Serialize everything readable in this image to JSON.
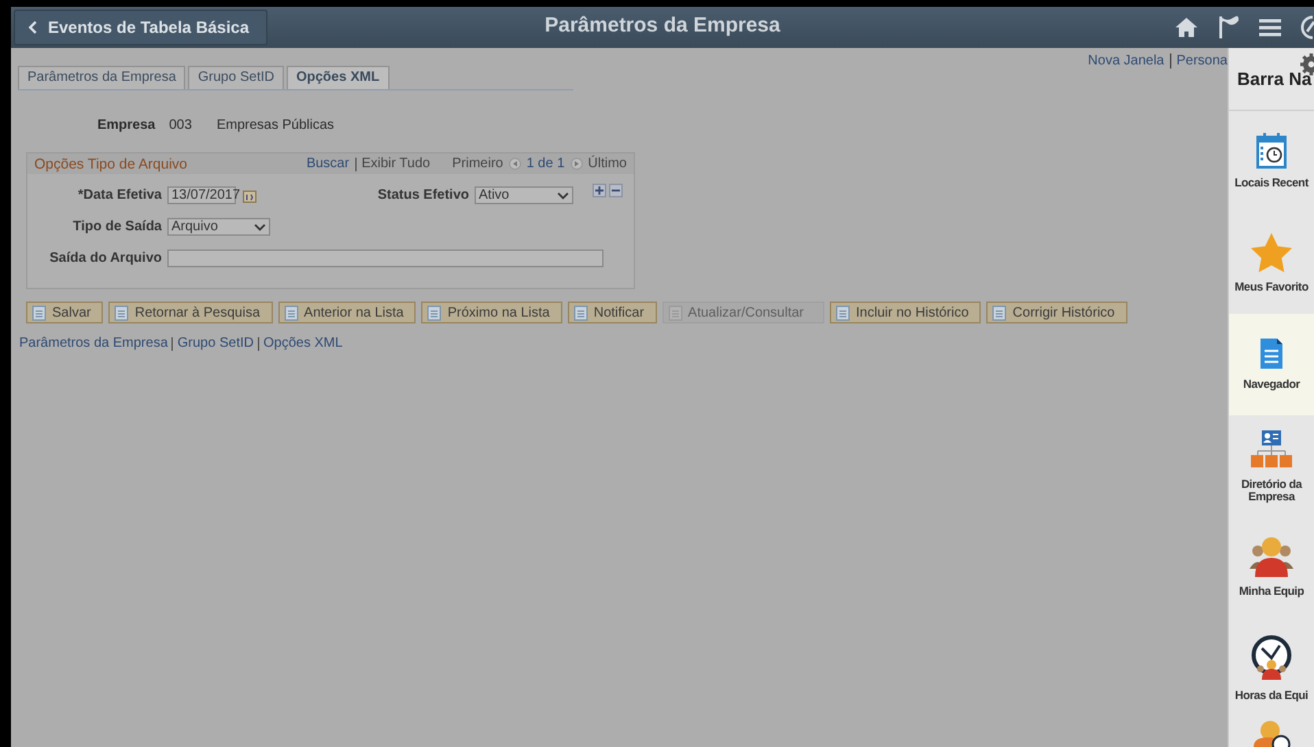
{
  "header": {
    "back_label": "Eventos de Tabela Básica",
    "title": "Parâmetros da Empresa"
  },
  "top_links": [
    "Nova Janela",
    "Persona"
  ],
  "tabs": [
    {
      "label": "Parâmetros da Empresa",
      "selected": false
    },
    {
      "label": "Grupo SetID",
      "selected": false
    },
    {
      "label": "Opções XML",
      "selected": true
    }
  ],
  "company": {
    "label": "Empresa",
    "code": "003",
    "name": "Empresas Públicas"
  },
  "group": {
    "title": "Opções Tipo de Arquivo",
    "links": [
      "Buscar",
      "Exibir Tudo"
    ],
    "first": "Primeiro",
    "count": "1 de 1",
    "last": "Último",
    "rows": [
      [
        {
          "kind": "date",
          "label": "*Data Efetiva",
          "value": "13/07/2017"
        },
        {
          "kind": "select",
          "label": "Status Efetivo",
          "value": "Ativo"
        }
      ],
      [
        {
          "kind": "select",
          "label": "Tipo de Saída",
          "value": "Arquivo"
        }
      ],
      [
        {
          "kind": "text",
          "label": "Saída do Arquivo"
        }
      ]
    ]
  },
  "buttons": [
    {
      "label": "Salvar",
      "disabled": false
    },
    {
      "label": "Retornar à Pesquisa",
      "disabled": false
    },
    {
      "label": "Anterior na Lista",
      "disabled": false
    },
    {
      "label": "Próximo na Lista",
      "disabled": false
    },
    {
      "label": "Notificar",
      "disabled": false
    },
    {
      "label": "Atualizar/Consultar",
      "disabled": true
    },
    {
      "label": "Incluir no Histórico",
      "disabled": false
    },
    {
      "label": "Corrigir Histórico",
      "disabled": false
    }
  ],
  "bottom_links": [
    "Parâmetros da Empresa",
    "Grupo SetID",
    "Opções XML"
  ],
  "nav_panel": {
    "title": "Barra Na",
    "items": [
      {
        "kind": "calendar",
        "label": "Locais Recent",
        "selected": false
      },
      {
        "kind": "star",
        "label": "Meus Favorito",
        "selected": false
      },
      {
        "kind": "document",
        "label": "Navegador",
        "selected": true
      },
      {
        "kind": "org",
        "label": "Diretório da Empresa",
        "selected": false
      },
      {
        "kind": "team",
        "label": "Minha Equip",
        "selected": false
      },
      {
        "kind": "clock",
        "label": "Horas da Equi",
        "selected": false
      },
      {
        "kind": "person",
        "selected": false
      }
    ]
  }
}
